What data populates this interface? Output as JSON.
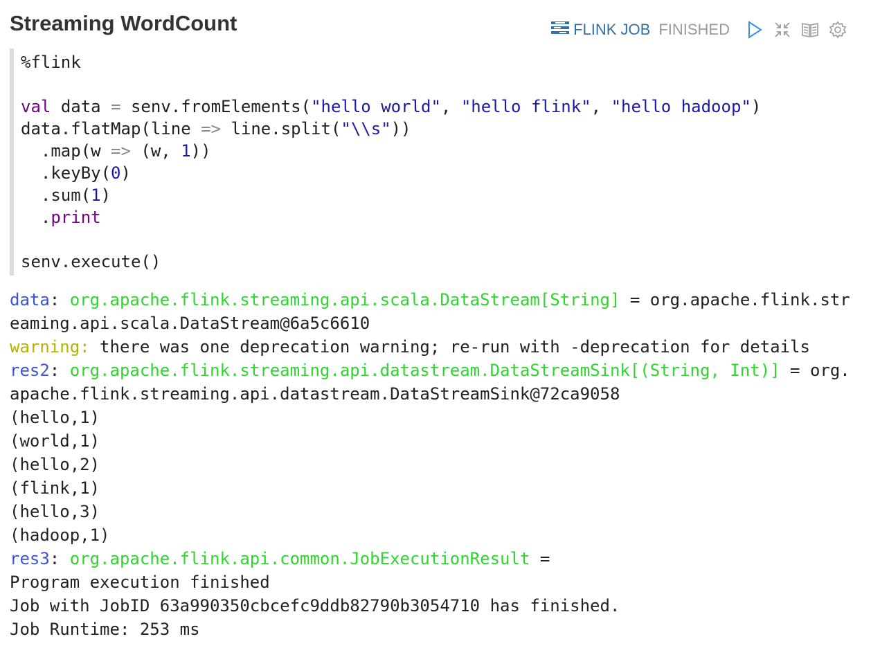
{
  "paragraph": {
    "title": "Streaming WordCount",
    "job_label": "FLINK JOB",
    "status": "FINISHED"
  },
  "code": {
    "interpreter": "%flink",
    "line3": {
      "kw": "val",
      "name": "data",
      "eq": "=",
      "call": "senv.fromElements(",
      "s1": "\"hello world\"",
      "s2": "\"hello flink\"",
      "s3": "\"hello hadoop\"",
      "close": ")"
    },
    "line4": {
      "a": "data.flatMap(line",
      "arrow": "=>",
      "b": "line.split(",
      "s": "\"\\\\s\"",
      "c": "))"
    },
    "line5": {
      "a": "  .map(w",
      "arrow": "=>",
      "b": "(w, ",
      "n": "1",
      "c": "))"
    },
    "line6": {
      "a": "  .keyBy(",
      "n": "0",
      "c": ")"
    },
    "line7": {
      "a": "  .sum(",
      "n": "1",
      "c": ")"
    },
    "line8": {
      "dot": "  .",
      "kw": "print"
    },
    "line10": "senv.execute()"
  },
  "output": {
    "l1": {
      "name": "data",
      "colon": ": ",
      "type": "org.apache.flink.streaming.api.scala.DataStream[String]",
      "rest": " = org.apache.flink.str"
    },
    "l2": "eaming.api.scala.DataStream@6a5c6610",
    "l3": {
      "warn": "warning:",
      "rest": " there was one deprecation warning; re-run with -deprecation for details"
    },
    "l4": {
      "name": "res2",
      "colon": ": ",
      "type": "org.apache.flink.streaming.api.datastream.DataStreamSink[(String, Int)]",
      "rest": " = org."
    },
    "l5": "apache.flink.streaming.api.datastream.DataStreamSink@72ca9058",
    "results": [
      "(hello,1)",
      "(world,1)",
      "(hello,2)",
      "(flink,1)",
      "(hello,3)",
      "(hadoop,1)"
    ],
    "l12": {
      "name": "res3",
      "colon": ": ",
      "type": "org.apache.flink.api.common.JobExecutionResult",
      "rest": " ="
    },
    "l13": "Program execution finished",
    "l14": "Job with JobID 63a990350cbcefc9ddb82790b3054710 has finished.",
    "l15": "Job Runtime: 253 ms"
  },
  "icons": [
    "tasks-icon",
    "play-icon",
    "compress-icon",
    "book-icon",
    "gear-icon"
  ],
  "colors": {
    "accent": "#3071a9",
    "type": "#2ed52e",
    "var": "#3b54d9",
    "warning": "#b3b300",
    "keyword": "#770088",
    "string": "#1a1aa6"
  }
}
